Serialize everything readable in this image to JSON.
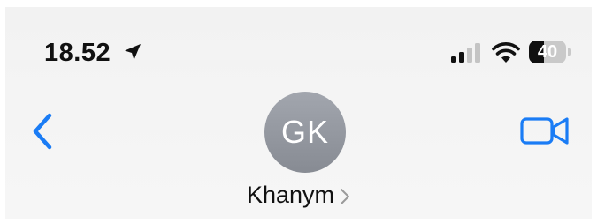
{
  "status_bar": {
    "time": "18.52",
    "battery_level": "40",
    "battery_fraction": 0.4,
    "icons": [
      "location-arrow-icon",
      "cellular-signal-icon",
      "wifi-icon",
      "battery-icon"
    ]
  },
  "nav": {
    "back_icon": "chevron-left-icon",
    "video_icon": "video-camera-icon",
    "accent_color": "#1a7cf5"
  },
  "contact": {
    "initials": "GK",
    "name": "Khanym",
    "name_chevron_icon": "chevron-right-icon"
  }
}
